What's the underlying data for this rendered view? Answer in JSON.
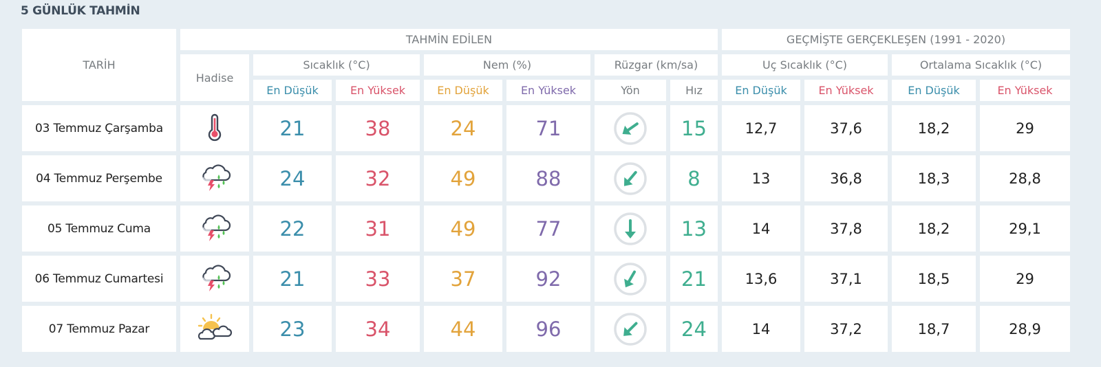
{
  "title": "5 GÜNLÜK TAHMİN",
  "headers": {
    "date": "TARİH",
    "forecast_group": "TAHMİN EDİLEN",
    "history_group": "GEÇMİŞTE GERÇEKLEŞEN (1991 - 2020)",
    "event": "Hadise",
    "temperature": "Sıcaklık (°C)",
    "humidity": "Nem (%)",
    "wind": "Rüzgar (km/sa)",
    "extreme_temp": "Uç Sıcaklık (°C)",
    "average_temp": "Ortalama Sıcaklık (°C)",
    "min": "En Düşük",
    "max": "En Yüksek",
    "direction": "Yön",
    "speed": "Hız"
  },
  "colors": {
    "temp_min": "#3b8eab",
    "temp_max": "#d9546a",
    "humidity_min": "#e2a33b",
    "humidity_max": "#7f6aab",
    "wind": "#3fae8f"
  },
  "rows": [
    {
      "date": "03 Temmuz Çarşamba",
      "event_icon": "thermometer-hot-icon",
      "temp_min": "21",
      "temp_max": "38",
      "hum_min": "24",
      "hum_max": "71",
      "wind_dir_deg": 235,
      "wind_speed": "15",
      "ext_min": "12,7",
      "ext_max": "37,6",
      "avg_min": "18,2",
      "avg_max": "29"
    },
    {
      "date": "04 Temmuz Perşembe",
      "event_icon": "thunderstorm-rain-icon",
      "temp_min": "24",
      "temp_max": "32",
      "hum_min": "49",
      "hum_max": "88",
      "wind_dir_deg": 220,
      "wind_speed": "8",
      "ext_min": "13",
      "ext_max": "36,8",
      "avg_min": "18,3",
      "avg_max": "28,8"
    },
    {
      "date": "05 Temmuz Cuma",
      "event_icon": "thunderstorm-rain-icon",
      "temp_min": "22",
      "temp_max": "31",
      "hum_min": "49",
      "hum_max": "77",
      "wind_dir_deg": 180,
      "wind_speed": "13",
      "ext_min": "14",
      "ext_max": "37,8",
      "avg_min": "18,2",
      "avg_max": "29,1"
    },
    {
      "date": "06 Temmuz Cumartesi",
      "event_icon": "thunderstorm-rain-icon",
      "temp_min": "21",
      "temp_max": "33",
      "hum_min": "37",
      "hum_max": "92",
      "wind_dir_deg": 210,
      "wind_speed": "21",
      "ext_min": "13,6",
      "ext_max": "37,1",
      "avg_min": "18,5",
      "avg_max": "29"
    },
    {
      "date": "07 Temmuz Pazar",
      "event_icon": "partly-cloudy-sun-icon",
      "temp_min": "23",
      "temp_max": "34",
      "hum_min": "44",
      "hum_max": "96",
      "wind_dir_deg": 225,
      "wind_speed": "24",
      "ext_min": "14",
      "ext_max": "37,2",
      "avg_min": "18,7",
      "avg_max": "28,9"
    }
  ]
}
